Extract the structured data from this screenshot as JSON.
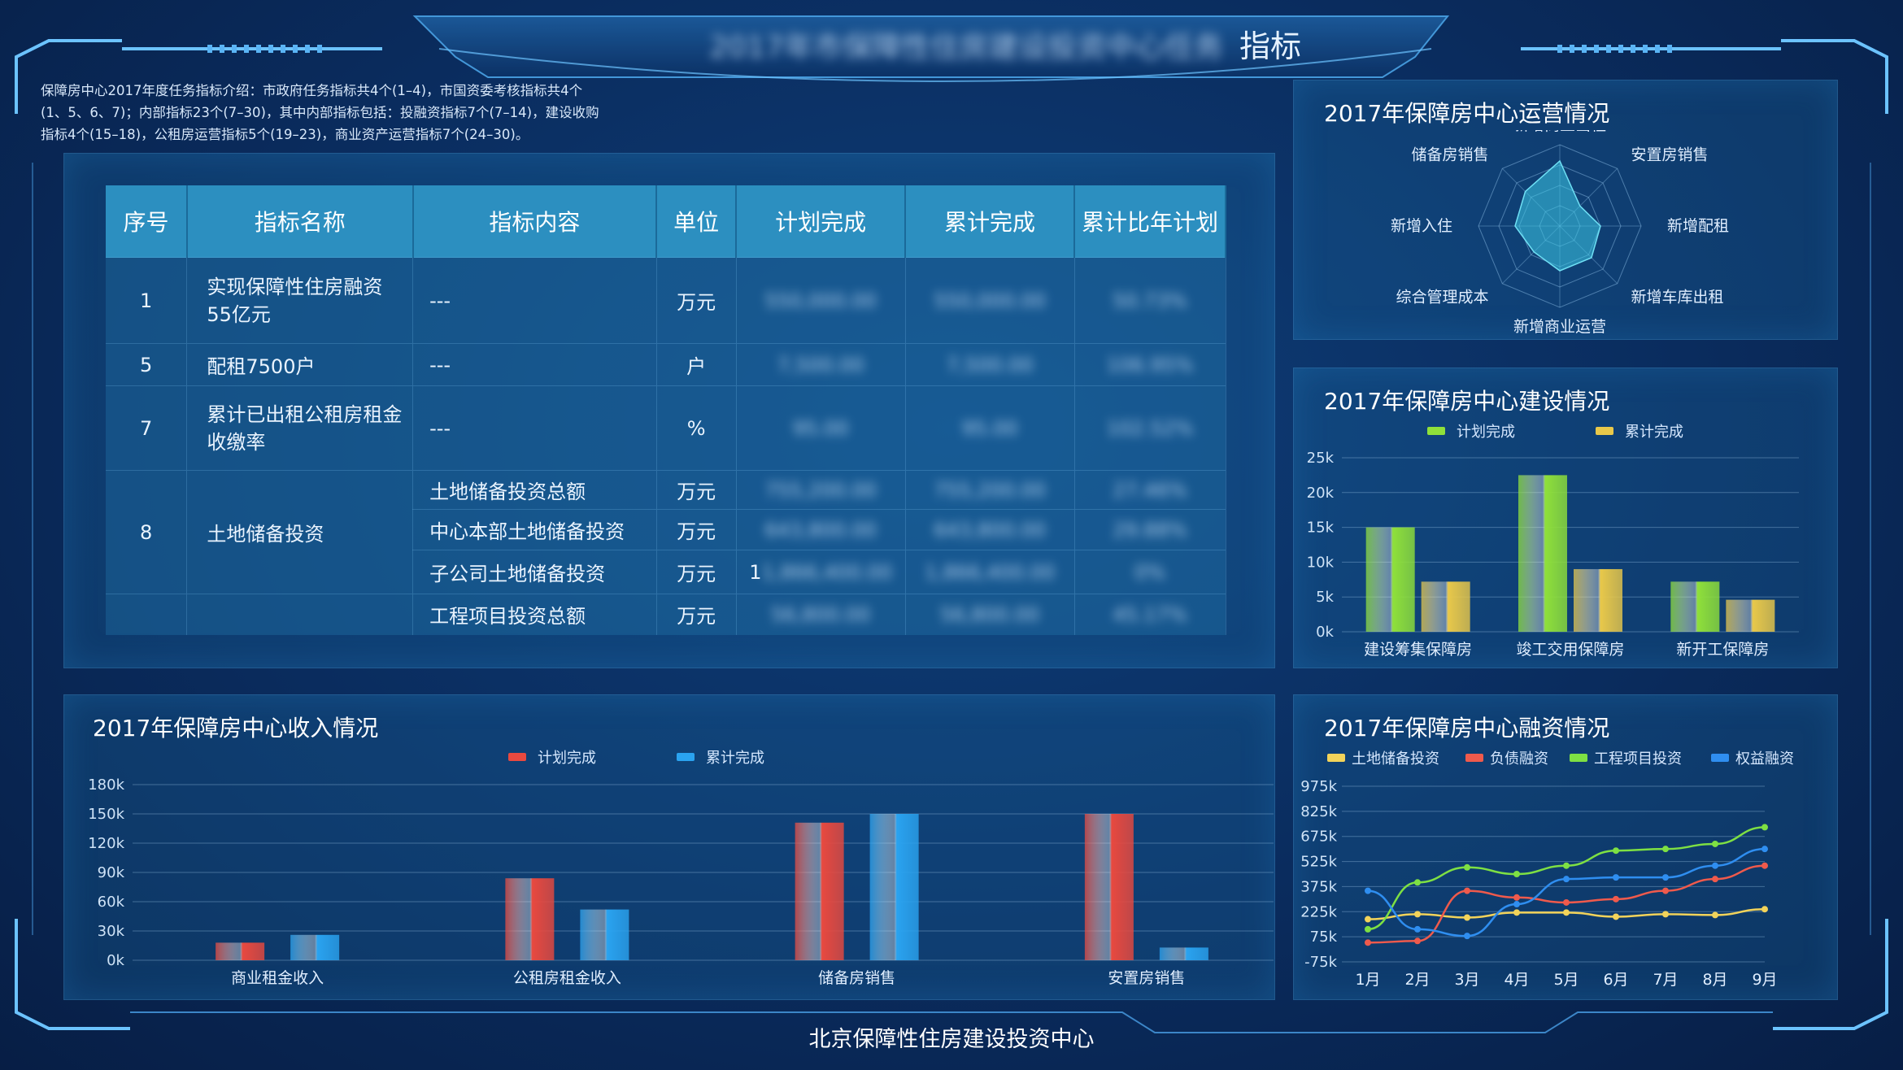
{
  "header": {
    "title_blurred": "2017年市保障性住房建设投资中心任务",
    "title_suffix": "指标"
  },
  "intro_text": "保障房中心2017年度任务指标介绍：市政府任务指标共4个(1–4)，市国资委考核指标共4个(1、5、6、7)；内部指标23个(7–30)，其中内部指标包括：投融资指标7个(7–14)，建设收购指标4个(15–18)，公租房运营指标5个(19–23)，商业资产运营指标7个(24–30)。",
  "table": {
    "headers": [
      "序号",
      "指标名称",
      "指标内容",
      "单位",
      "计划完成",
      "累计完成",
      "累计比年计划"
    ],
    "rows": [
      {
        "no": "1",
        "name": "实现保障性住房融资55亿元",
        "content": "---",
        "unit": "万元",
        "plan": "550,000.00",
        "cum": "550,000.00",
        "ratio": "50.73%"
      },
      {
        "no": "5",
        "name": "配租7500户",
        "content": "---",
        "unit": "户",
        "plan": "7,500.00",
        "cum": "7,500.00",
        "ratio": "106.95%"
      },
      {
        "no": "7",
        "name": "累计已出租公租房租金收缴率",
        "content": "---",
        "unit": "%",
        "plan": "95.00",
        "cum": "95.00",
        "ratio": "102.52%"
      }
    ],
    "group": {
      "no": "8",
      "name": "土地储备投资",
      "subrows": [
        {
          "content": "土地储备投资总额",
          "unit": "万元",
          "plan": "755,200.00",
          "cum": "755,200.00",
          "ratio": "27.46%"
        },
        {
          "content": "中心本部土地储备投资",
          "unit": "万元",
          "plan": "643,800.00",
          "cum": "643,800.00",
          "ratio": "29.88%"
        },
        {
          "content": "子公司土地储备投资",
          "unit": "万元",
          "plan_prefix": "1",
          "plan": "1,866,400.00",
          "cum": "1,866,400.00",
          "ratio": "0%"
        },
        {
          "content": "工程项目投资总额",
          "unit": "万元",
          "plan": "56,800.00",
          "cum": "56,800.00",
          "ratio": "45.17%"
        }
      ]
    }
  },
  "radar_panel": {
    "title": "2017年保障房中心运营情况",
    "indicators": [
      "新增商业出租",
      "安置房销售",
      "新增配租",
      "新增车库出租",
      "新增商业运营",
      "综合管理成本",
      "新增入住",
      "储备房销售"
    ],
    "values": [
      0.8,
      0.35,
      0.5,
      0.55,
      0.55,
      0.45,
      0.55,
      0.6
    ]
  },
  "construction_panel": {
    "title": "2017年保障房中心建设情况",
    "chart_data": {
      "type": "bar",
      "categories": [
        "建设筹集保障房",
        "竣工交用保障房",
        "新开工保障房"
      ],
      "series": [
        {
          "name": "计划完成",
          "values": [
            15000,
            22500,
            7200
          ],
          "color": "#8fe03a"
        },
        {
          "name": "累计完成",
          "values": [
            7200,
            9000,
            4600
          ],
          "color": "#e8c84a"
        }
      ],
      "y_ticks": [
        "25k",
        "20k",
        "15k",
        "10k",
        "5k",
        "0k"
      ],
      "ylim": [
        0,
        25000
      ]
    }
  },
  "income_panel": {
    "title": "2017年保障房中心收入情况",
    "chart_data": {
      "type": "bar",
      "categories": [
        "商业租金收入",
        "公租房租金收入",
        "储备房销售",
        "安置房销售"
      ],
      "series": [
        {
          "name": "计划完成",
          "values": [
            18000,
            84000,
            141000,
            150000
          ],
          "color": "#e8493f"
        },
        {
          "name": "累计完成",
          "values": [
            26000,
            52000,
            150000,
            13000
          ],
          "color": "#2aa3f0"
        }
      ],
      "y_ticks": [
        "180k",
        "150k",
        "120k",
        "90k",
        "60k",
        "30k",
        "0k"
      ],
      "ylim": [
        0,
        180000
      ]
    }
  },
  "finance_panel": {
    "title": "2017年保障房中心融资情况",
    "chart_data": {
      "type": "line",
      "x": [
        "1月",
        "2月",
        "3月",
        "4月",
        "5月",
        "6月",
        "7月",
        "8月",
        "9月"
      ],
      "series": [
        {
          "name": "土地储备投资",
          "values": [
            180,
            210,
            190,
            220,
            220,
            195,
            210,
            205,
            240
          ],
          "color": "#f2d35a"
        },
        {
          "name": "负债融资",
          "values": [
            40,
            50,
            350,
            310,
            280,
            300,
            350,
            420,
            500
          ],
          "color": "#ef5a4c"
        },
        {
          "name": "工程项目投资",
          "values": [
            120,
            400,
            490,
            450,
            500,
            590,
            600,
            630,
            730
          ],
          "color": "#7ee043"
        },
        {
          "name": "权益融资",
          "values": [
            350,
            120,
            80,
            270,
            420,
            430,
            430,
            500,
            600
          ],
          "color": "#2f8ef0"
        }
      ],
      "y_ticks": [
        "975k",
        "825k",
        "675k",
        "525k",
        "375k",
        "225k",
        "75k",
        "-75k"
      ],
      "ylim": [
        -75,
        975
      ]
    }
  },
  "footer": {
    "org_name": "北京保障性住房建设投资中心"
  }
}
